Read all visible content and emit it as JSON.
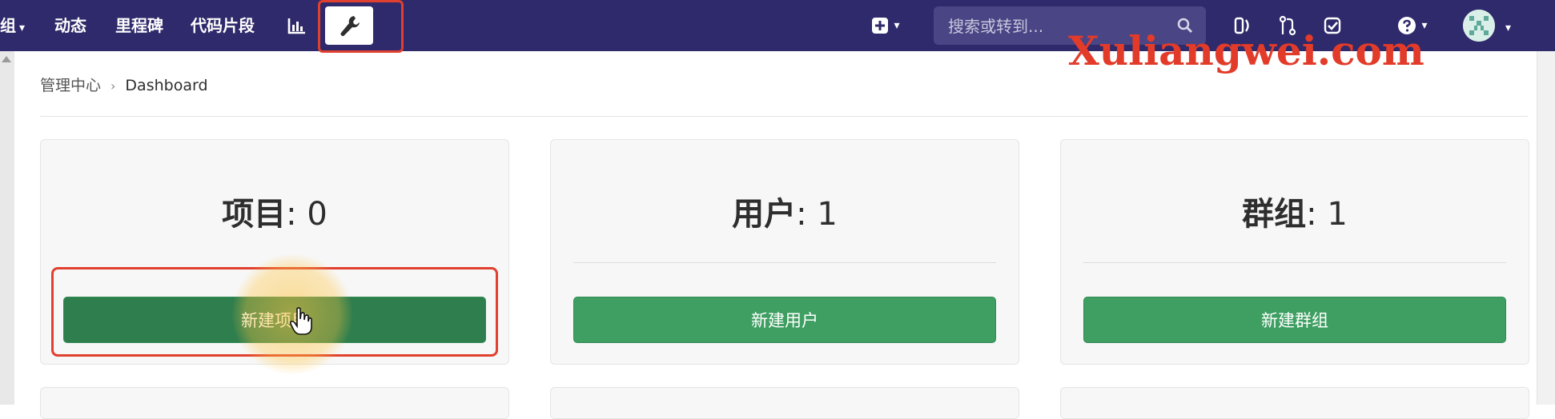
{
  "nav": {
    "partial_item": "组",
    "items": [
      "动态",
      "里程碑",
      "代码片段"
    ],
    "search_placeholder": "搜索或转到..."
  },
  "icons": {
    "projects_dropdown": "chevron-down-icon",
    "analytics": "bar-chart-icon",
    "admin": "wrench-icon",
    "new": "plus-square-icon",
    "search": "search-icon",
    "issues": "issues-icon",
    "merge_requests": "merge-request-icon",
    "todos": "todo-check-icon",
    "help": "help-circle-icon",
    "user": "avatar"
  },
  "breadcrumb": {
    "root": "管理中心",
    "current": "Dashboard"
  },
  "cards": [
    {
      "label": "项目",
      "count": ": 0",
      "button": "新建项目"
    },
    {
      "label": "用户",
      "count": ": 1",
      "button": "新建用户"
    },
    {
      "label": "群组",
      "count": ": 1",
      "button": "新建群组"
    }
  ],
  "watermark": "Xuliangwei.com",
  "colors": {
    "navbar": "#2f2a6b",
    "search_bg": "#4a4584",
    "button_green": "#3f9f62",
    "highlight_red": "#e0402f",
    "watermark_red": "#e23b2a"
  }
}
